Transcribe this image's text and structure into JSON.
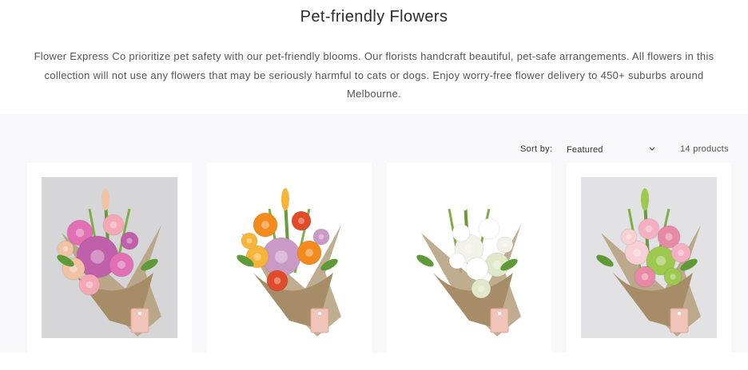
{
  "collection": {
    "title": "Pet-friendly Flowers",
    "description": "Flower Express Co prioritize pet safety with our pet-friendly blooms. Our florists handcraft beautiful, pet-safe arrangements. All flowers in this collection will not use any flowers that may be seriously harmful to cats or dogs. Enjoy worry-free flower delivery to 450+ suburbs around Melbourne."
  },
  "toolbar": {
    "sort_label": "Sort by:",
    "sort_selected": "Featured",
    "product_count": "14 products"
  },
  "products": [
    {
      "image": "bouquet-pink-peony",
      "palette": [
        "#e06fb4",
        "#f4a8b6",
        "#c05faa",
        "#f2c2a4"
      ]
    },
    {
      "image": "bouquet-orange-mix",
      "palette": [
        "#f28a1c",
        "#e04b2a",
        "#c99ac6",
        "#f6b53a"
      ]
    },
    {
      "image": "bouquet-white-daisy",
      "palette": [
        "#ffffff",
        "#f2f2ea",
        "#dfe8c8",
        "#ffffff"
      ]
    },
    {
      "image": "bouquet-pastel-pink",
      "palette": [
        "#f4b0c2",
        "#e889a6",
        "#f7d0d6",
        "#9cc94e"
      ]
    }
  ],
  "colors": {
    "page_bg": "#ffffff",
    "grid_bg": "#f8f8fa",
    "hessian": "#b59e7b",
    "tag": "#f0c4b8"
  }
}
